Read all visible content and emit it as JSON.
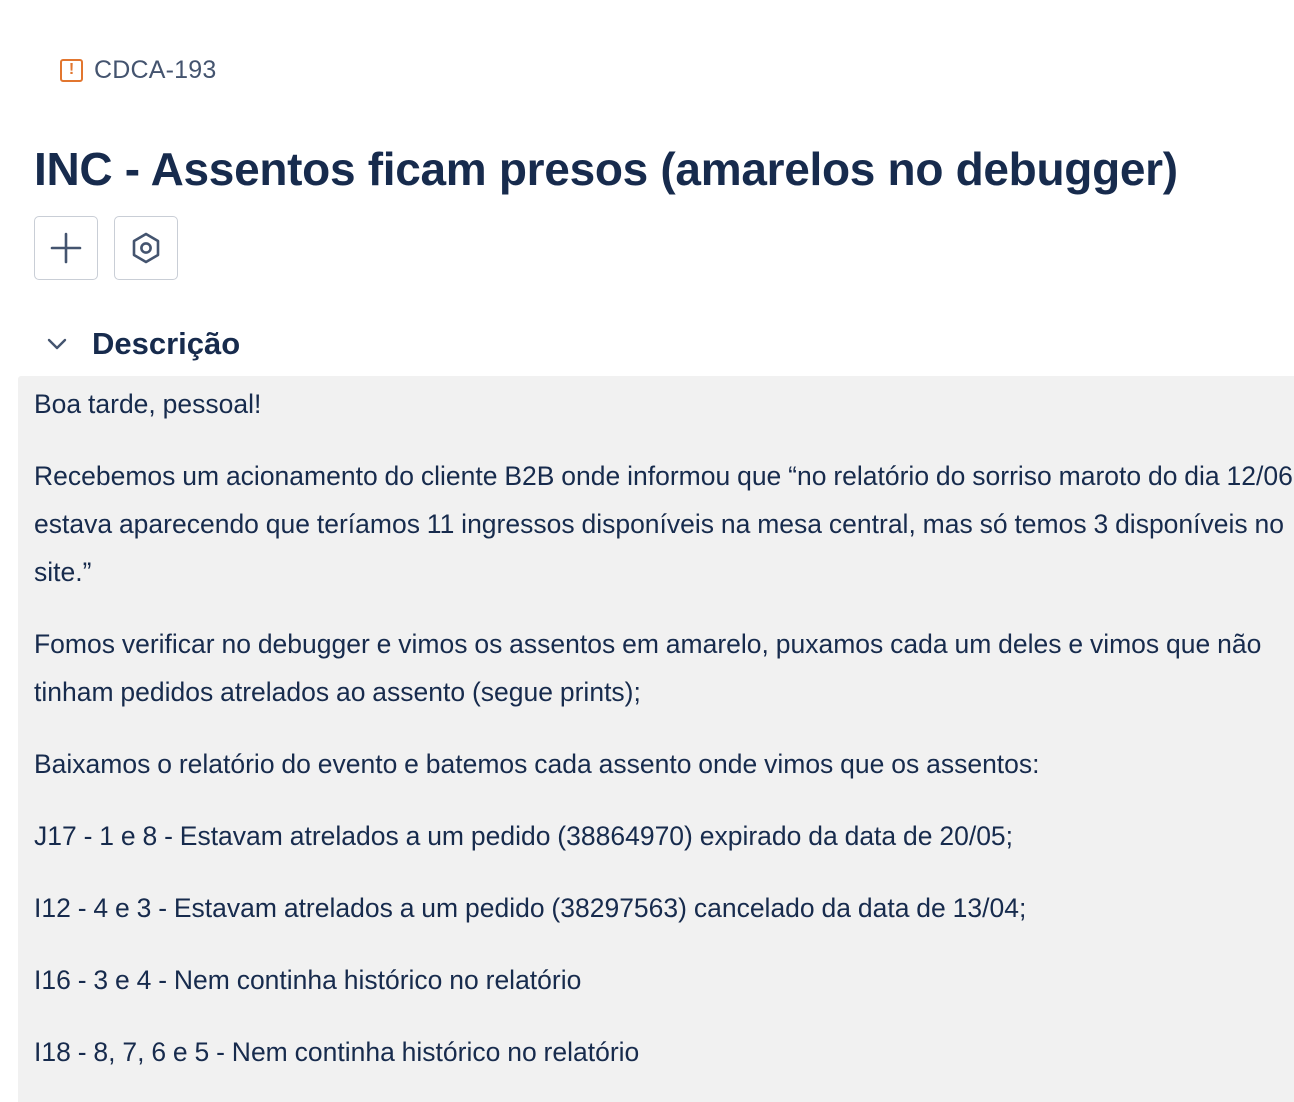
{
  "issue": {
    "key": "CDCA-193",
    "type_icon": "exclamation-icon",
    "type_color": "#e2762f",
    "title": "INC - Assentos ficam presos (amarelos no debugger)"
  },
  "actions": [
    {
      "name": "add",
      "icon": "plus-icon"
    },
    {
      "name": "apps",
      "icon": "hexagon-gear-icon"
    }
  ],
  "description": {
    "heading": "Descrição",
    "paragraphs": [
      "Boa tarde, pessoal!",
      "Recebemos um acionamento do cliente B2B onde informou que “no relatório do sorriso maroto do dia 12/06 estava aparecendo que teríamos 11 ingressos disponíveis na mesa central, mas só temos 3 disponíveis no site.”",
      "Fomos verificar no debugger e vimos os assentos em amarelo, puxamos cada um deles e vimos que não tinham pedidos atrelados ao assento (segue prints);",
      "Baixamos o relatório do evento e batemos cada assento onde vimos que os assentos:",
      "J17 - 1 e 8 - Estavam atrelados a um pedido (38864970) expirado da data de 20/05;",
      "I12 - 4 e 3 - Estavam atrelados a um pedido (38297563) cancelado da data de 13/04;",
      "I16 - 3 e 4 - Nem continha histórico no relatório",
      "I18 - 8, 7, 6 e 5 -  Nem continha histórico no relatório"
    ]
  }
}
